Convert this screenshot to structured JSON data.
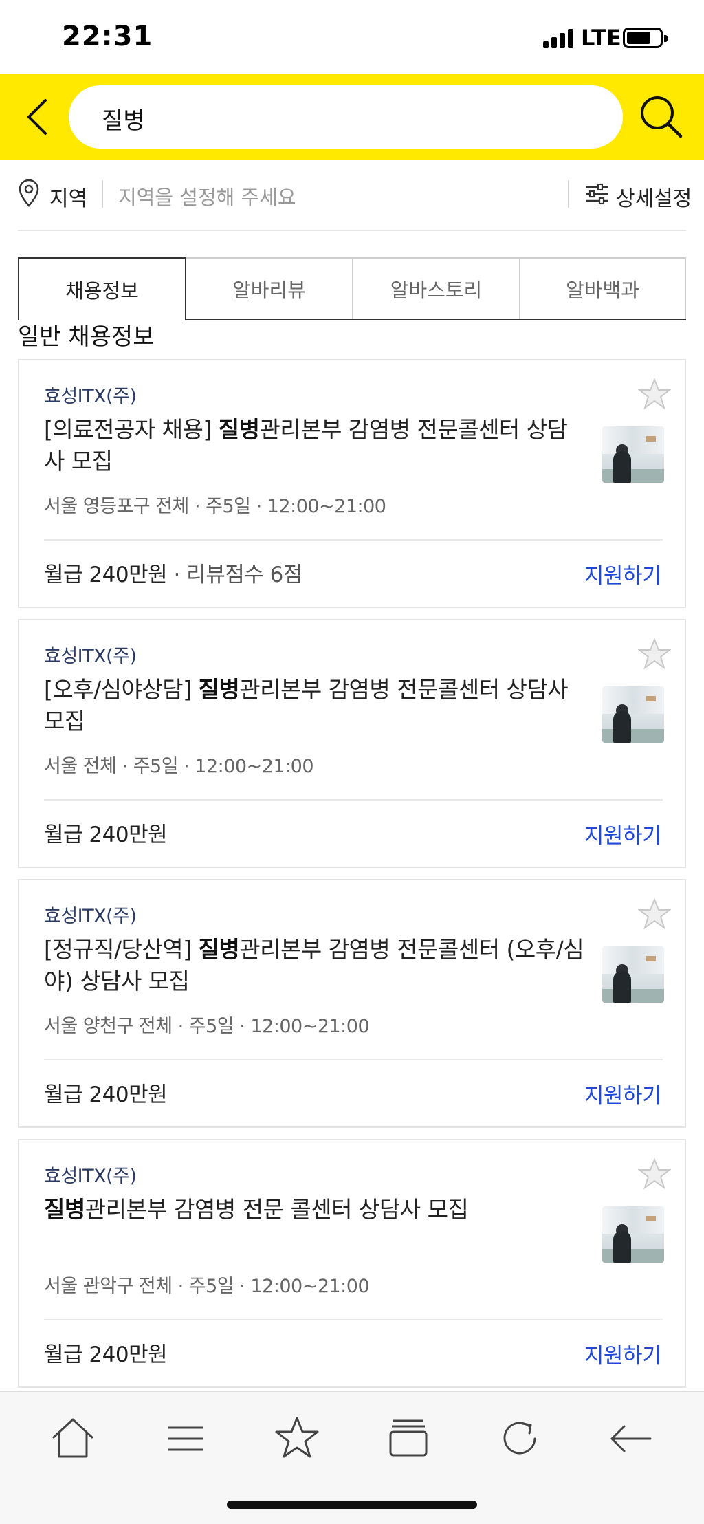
{
  "status_bar": {
    "time": "22:31",
    "network": "LTE"
  },
  "search": {
    "query": "질병"
  },
  "region": {
    "label": "지역",
    "placeholder": "지역을 설정해 주세요",
    "detail_label": "상세설정"
  },
  "tabs": [
    {
      "label": "채용정보",
      "active": true
    },
    {
      "label": "알바리뷰",
      "active": false
    },
    {
      "label": "알바스토리",
      "active": false
    },
    {
      "label": "알바백과",
      "active": false
    }
  ],
  "section_title": "일반 채용정보",
  "listings": [
    {
      "company": "효성ITX(주)",
      "title_pre": "[의료전공자 채용] ",
      "title_highlight": "질병",
      "title_post": "관리본부 감염병 전문콜센터 상담사 모집",
      "meta": "서울 영등포구 전체 · 주5일 · 12:00~21:00",
      "salary": "월급 240만원",
      "review": " · 리뷰점수 6점",
      "apply_label": "지원하기"
    },
    {
      "company": "효성ITX(주)",
      "title_pre": "[오후/심야상담] ",
      "title_highlight": "질병",
      "title_post": "관리본부 감염병 전문콜센터 상담사 모집",
      "meta": "서울 전체 · 주5일 · 12:00~21:00",
      "salary": "월급 240만원",
      "review": "",
      "apply_label": "지원하기"
    },
    {
      "company": "효성ITX(주)",
      "title_pre": "[정규직/당산역] ",
      "title_highlight": "질병",
      "title_post": "관리본부 감염병 전문콜센터 (오후/심야) 상담사 모집",
      "meta": "서울 양천구 전체 · 주5일 · 12:00~21:00",
      "salary": "월급 240만원",
      "review": "",
      "apply_label": "지원하기"
    },
    {
      "company": "효성ITX(주)",
      "title_pre": "",
      "title_highlight": "질병",
      "title_post": "관리본부 감염병 전문 콜센터 상담사 모집",
      "meta": "서울 관악구 전체 · 주5일 · 12:00~21:00",
      "salary": "월급 240만원",
      "review": "",
      "apply_label": "지원하기"
    }
  ],
  "toolbar_icons": [
    "home-icon",
    "menu-icon",
    "bookmark-star-icon",
    "tabs-icon",
    "reload-icon",
    "back-arrow-icon"
  ],
  "colors": {
    "header_yellow": "#ffe900",
    "apply_blue": "#1f49d6",
    "company_navy": "#2b3a63"
  }
}
